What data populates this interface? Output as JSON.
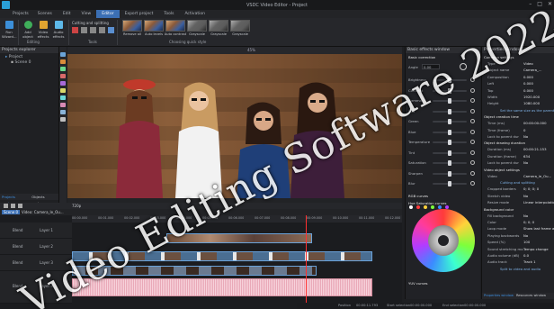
{
  "window": {
    "title": "VSDC Video Editor - Project"
  },
  "menu": {
    "items": [
      "Projects",
      "Scenes",
      "Edit",
      "View",
      "Editor",
      "Export project",
      "Tools",
      "Activation"
    ],
    "active": "Editor"
  },
  "ribbon": {
    "run_wizard": "Run Wizard...",
    "add_object": "Add object",
    "video_effects": "Video effects",
    "audio_effects": "Audio effects",
    "editing_label": "Editing",
    "cutting_label": "Cutting and splitting",
    "tools_label": "Tools",
    "quick_style_label": "Choosing quick style",
    "styles": [
      "Remove all",
      "Auto levels",
      "Auto contrast",
      "Grayscale",
      "Grayscale",
      "Grayscale"
    ]
  },
  "project_explorer": {
    "title": "Projects explorer",
    "items": [
      "Project",
      "Scene 0"
    ],
    "tabs": [
      "Projects explorer",
      "Objects explorer"
    ]
  },
  "viewbar": {
    "zoom": "45%"
  },
  "timeline": {
    "scene_tab": "Scene 0",
    "video_tab": "Video: Camera_le_Ou...",
    "zoom": "720p",
    "ruler": [
      "00:00.000",
      "00:01.000",
      "00:02.000",
      "00:03.000",
      "00:04.000",
      "00:05.000",
      "00:06.000",
      "00:07.000",
      "00:08.000",
      "00:09.000",
      "00:10.000",
      "00:11.000",
      "00:12.000"
    ],
    "tracks": [
      {
        "blend": "Blend",
        "name": "Layer 1"
      },
      {
        "blend": "Blend",
        "name": "Layer 2"
      },
      {
        "blend": "Blend",
        "name": "Layer 3"
      },
      {
        "blend": "Blend",
        "name": "Layer 4"
      }
    ]
  },
  "basic_effects": {
    "title": "Basic effects window",
    "angle_label": "Angle",
    "angle_value": "0.00",
    "sections": [
      "Basic correction",
      "RGB curves",
      "Hue Saturation curves",
      "YUV curves"
    ],
    "rows": [
      {
        "label": "Brightness",
        "value": 0.5
      },
      {
        "label": "Contrast",
        "value": 0.5
      },
      {
        "label": "Gamma",
        "value": 0.5
      },
      {
        "label": "Red",
        "value": 0.5
      },
      {
        "label": "Green",
        "value": 0.5
      },
      {
        "label": "Blue",
        "value": 0.5
      },
      {
        "label": "Temperature",
        "value": 0.5
      },
      {
        "label": "Tint",
        "value": 0.5
      },
      {
        "label": "Saturation",
        "value": 0.5
      },
      {
        "label": "Sharpen",
        "value": 0.5
      },
      {
        "label": "Blur",
        "value": 0.5
      }
    ],
    "swatch_colors": [
      "#ffffff",
      "#ff3b3b",
      "#ffd23b",
      "#7dff3b",
      "#3b8bff",
      "#b43bff"
    ]
  },
  "properties": {
    "title": "Properties window",
    "sections": [
      "Common settings",
      "Object creation time",
      "Object drawing duration",
      "Video object settings",
      "Background color"
    ],
    "rows": [
      {
        "label": "Type",
        "value": "Video"
      },
      {
        "label": "Object name",
        "value": "Camera_..."
      },
      {
        "label": "Composition",
        "value": "0.000"
      },
      {
        "label": "Left",
        "value": "0.000"
      },
      {
        "label": "Top",
        "value": "0.000"
      },
      {
        "label": "Width",
        "value": "1920.000"
      },
      {
        "label": "Height",
        "value": "1080.000"
      },
      {
        "label": "Set the same size as the parent has",
        "value": ""
      },
      {
        "label": "Time (ms)",
        "value": "00:00:00.000"
      },
      {
        "label": "Time (frame)",
        "value": "0"
      },
      {
        "label": "Lock to parent dur",
        "value": "No"
      },
      {
        "label": "Duration (ms)",
        "value": "00:00:21.153"
      },
      {
        "label": "Duration (frame)",
        "value": "634"
      },
      {
        "label": "Lock to parent dur",
        "value": "No"
      },
      {
        "label": "Video",
        "value": "Camera_le_Ou..."
      },
      {
        "label": "Cutting and splitting",
        "value": ""
      },
      {
        "label": "Cropped borders",
        "value": "0; 0; 0; 0"
      },
      {
        "label": "Stretch video",
        "value": "No"
      },
      {
        "label": "Resize mode",
        "value": "Linear interpolation"
      },
      {
        "label": "Fill background",
        "value": "No"
      },
      {
        "label": "Color",
        "value": "0; 0; 0"
      },
      {
        "label": "Loop mode",
        "value": "Show last frame at..."
      },
      {
        "label": "Playing backwards",
        "value": "No"
      },
      {
        "label": "Speed (%)",
        "value": "100"
      },
      {
        "label": "Sound stretching mo",
        "value": "Tempo change"
      },
      {
        "label": "Audio volume (dB)",
        "value": "0.0"
      },
      {
        "label": "Audio track",
        "value": "Track 1"
      },
      {
        "label": "Split to video and audio",
        "value": ""
      }
    ],
    "tabs": [
      "Properties window",
      "Resources window"
    ]
  },
  "status": {
    "position_label": "Position",
    "position": "00:00:11.793",
    "start_label": "Start selection",
    "start": "00:00:00.000",
    "end_label": "End selection",
    "end": "00:00:00.000"
  },
  "watermark": {
    "text": "Video Editing Software 2022"
  }
}
